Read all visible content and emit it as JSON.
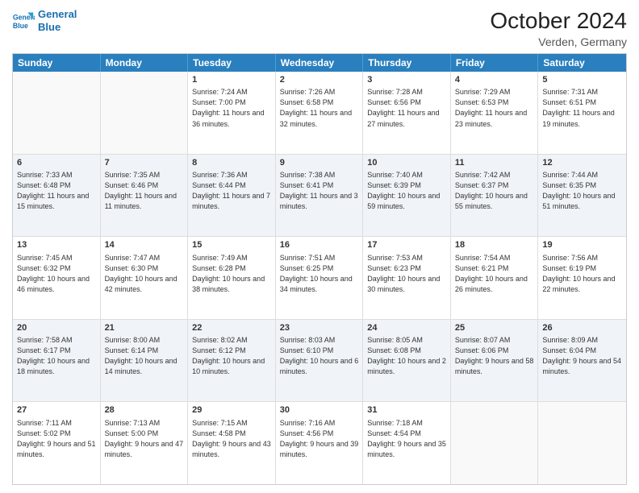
{
  "logo": {
    "line1": "General",
    "line2": "Blue"
  },
  "title": "October 2024",
  "location": "Verden, Germany",
  "days_of_week": [
    "Sunday",
    "Monday",
    "Tuesday",
    "Wednesday",
    "Thursday",
    "Friday",
    "Saturday"
  ],
  "weeks": [
    [
      {
        "day": "",
        "info": ""
      },
      {
        "day": "",
        "info": ""
      },
      {
        "day": "1",
        "info": "Sunrise: 7:24 AM\nSunset: 7:00 PM\nDaylight: 11 hours and 36 minutes."
      },
      {
        "day": "2",
        "info": "Sunrise: 7:26 AM\nSunset: 6:58 PM\nDaylight: 11 hours and 32 minutes."
      },
      {
        "day": "3",
        "info": "Sunrise: 7:28 AM\nSunset: 6:56 PM\nDaylight: 11 hours and 27 minutes."
      },
      {
        "day": "4",
        "info": "Sunrise: 7:29 AM\nSunset: 6:53 PM\nDaylight: 11 hours and 23 minutes."
      },
      {
        "day": "5",
        "info": "Sunrise: 7:31 AM\nSunset: 6:51 PM\nDaylight: 11 hours and 19 minutes."
      }
    ],
    [
      {
        "day": "6",
        "info": "Sunrise: 7:33 AM\nSunset: 6:48 PM\nDaylight: 11 hours and 15 minutes."
      },
      {
        "day": "7",
        "info": "Sunrise: 7:35 AM\nSunset: 6:46 PM\nDaylight: 11 hours and 11 minutes."
      },
      {
        "day": "8",
        "info": "Sunrise: 7:36 AM\nSunset: 6:44 PM\nDaylight: 11 hours and 7 minutes."
      },
      {
        "day": "9",
        "info": "Sunrise: 7:38 AM\nSunset: 6:41 PM\nDaylight: 11 hours and 3 minutes."
      },
      {
        "day": "10",
        "info": "Sunrise: 7:40 AM\nSunset: 6:39 PM\nDaylight: 10 hours and 59 minutes."
      },
      {
        "day": "11",
        "info": "Sunrise: 7:42 AM\nSunset: 6:37 PM\nDaylight: 10 hours and 55 minutes."
      },
      {
        "day": "12",
        "info": "Sunrise: 7:44 AM\nSunset: 6:35 PM\nDaylight: 10 hours and 51 minutes."
      }
    ],
    [
      {
        "day": "13",
        "info": "Sunrise: 7:45 AM\nSunset: 6:32 PM\nDaylight: 10 hours and 46 minutes."
      },
      {
        "day": "14",
        "info": "Sunrise: 7:47 AM\nSunset: 6:30 PM\nDaylight: 10 hours and 42 minutes."
      },
      {
        "day": "15",
        "info": "Sunrise: 7:49 AM\nSunset: 6:28 PM\nDaylight: 10 hours and 38 minutes."
      },
      {
        "day": "16",
        "info": "Sunrise: 7:51 AM\nSunset: 6:25 PM\nDaylight: 10 hours and 34 minutes."
      },
      {
        "day": "17",
        "info": "Sunrise: 7:53 AM\nSunset: 6:23 PM\nDaylight: 10 hours and 30 minutes."
      },
      {
        "day": "18",
        "info": "Sunrise: 7:54 AM\nSunset: 6:21 PM\nDaylight: 10 hours and 26 minutes."
      },
      {
        "day": "19",
        "info": "Sunrise: 7:56 AM\nSunset: 6:19 PM\nDaylight: 10 hours and 22 minutes."
      }
    ],
    [
      {
        "day": "20",
        "info": "Sunrise: 7:58 AM\nSunset: 6:17 PM\nDaylight: 10 hours and 18 minutes."
      },
      {
        "day": "21",
        "info": "Sunrise: 8:00 AM\nSunset: 6:14 PM\nDaylight: 10 hours and 14 minutes."
      },
      {
        "day": "22",
        "info": "Sunrise: 8:02 AM\nSunset: 6:12 PM\nDaylight: 10 hours and 10 minutes."
      },
      {
        "day": "23",
        "info": "Sunrise: 8:03 AM\nSunset: 6:10 PM\nDaylight: 10 hours and 6 minutes."
      },
      {
        "day": "24",
        "info": "Sunrise: 8:05 AM\nSunset: 6:08 PM\nDaylight: 10 hours and 2 minutes."
      },
      {
        "day": "25",
        "info": "Sunrise: 8:07 AM\nSunset: 6:06 PM\nDaylight: 9 hours and 58 minutes."
      },
      {
        "day": "26",
        "info": "Sunrise: 8:09 AM\nSunset: 6:04 PM\nDaylight: 9 hours and 54 minutes."
      }
    ],
    [
      {
        "day": "27",
        "info": "Sunrise: 7:11 AM\nSunset: 5:02 PM\nDaylight: 9 hours and 51 minutes."
      },
      {
        "day": "28",
        "info": "Sunrise: 7:13 AM\nSunset: 5:00 PM\nDaylight: 9 hours and 47 minutes."
      },
      {
        "day": "29",
        "info": "Sunrise: 7:15 AM\nSunset: 4:58 PM\nDaylight: 9 hours and 43 minutes."
      },
      {
        "day": "30",
        "info": "Sunrise: 7:16 AM\nSunset: 4:56 PM\nDaylight: 9 hours and 39 minutes."
      },
      {
        "day": "31",
        "info": "Sunrise: 7:18 AM\nSunset: 4:54 PM\nDaylight: 9 hours and 35 minutes."
      },
      {
        "day": "",
        "info": ""
      },
      {
        "day": "",
        "info": ""
      }
    ]
  ]
}
